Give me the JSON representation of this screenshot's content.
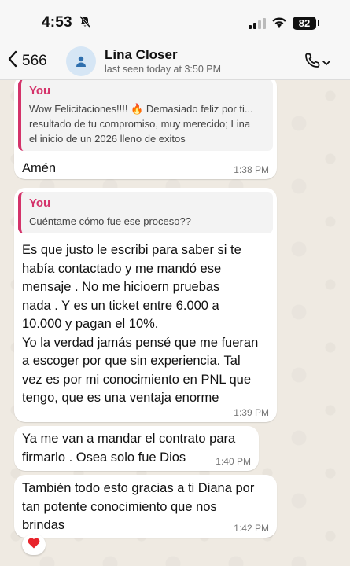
{
  "status_bar": {
    "time": "4:53",
    "battery": "82"
  },
  "header": {
    "back_count": "566",
    "contact_name": "Lina Closer",
    "last_seen": "last seen today at 3:50 PM"
  },
  "messages": [
    {
      "quote_author": "You",
      "quote_lines": [
        "Wow Felicitaciones!!!! 🔥 Demasiado feliz por ti...",
        "resultado de tu compromiso, muy merecido; Lina",
        "el inicio de un 2026 lleno de exitos"
      ],
      "text": "Amén",
      "time": "1:38 PM"
    },
    {
      "quote_author": "You",
      "quote_lines": [
        "Cuéntame cómo fue ese proceso??"
      ],
      "lines": [
        "Es que justo le escribi para saber si te",
        "había contactado y me mandó ese",
        "mensaje . No me hicioern pruebas",
        "nada . Y es un ticket entre 6.000 a",
        "10.000 y pagan el 10%.",
        "Yo la verdad jamás pensé que me fueran",
        "a escoger por que sin experiencia. Tal",
        "vez es por mi conocimiento en PNL que",
        "tengo, que es una ventaja enorme"
      ],
      "time": "1:39 PM"
    },
    {
      "lines": [
        "Ya me van a mandar el contrato para",
        "firmarlo . Osea solo fue Dios"
      ],
      "time": "1:40 PM"
    },
    {
      "lines": [
        "También todo esto gracias a ti Diana por",
        "tan potente conocimiento que nos",
        "brindas"
      ],
      "time": "1:42 PM",
      "reaction": "❤️"
    }
  ]
}
